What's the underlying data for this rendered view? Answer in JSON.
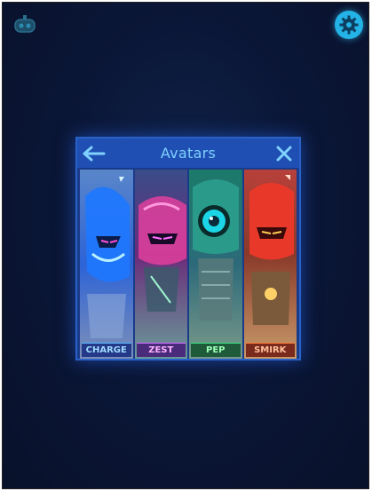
{
  "header": {
    "profile_icon": "robot-face-icon",
    "settings_icon": "gear-icon"
  },
  "modal": {
    "title": "Avatars",
    "back_icon": "arrow-left-icon",
    "close_icon": "close-icon",
    "avatars": [
      {
        "label": "CHARGE",
        "color": "#2f7bff"
      },
      {
        "label": "ZEST",
        "color": "#d44fd0"
      },
      {
        "label": "PEP",
        "color": "#2fc47a"
      },
      {
        "label": "SMIRK",
        "color": "#e8402c"
      }
    ]
  },
  "colors": {
    "background": "#0b1738",
    "modal": "#1a3b8a",
    "accent": "#23b3e6"
  }
}
